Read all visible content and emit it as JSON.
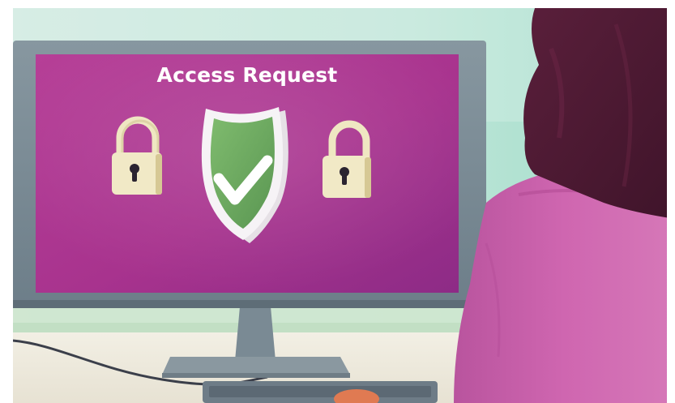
{
  "screen": {
    "title": "Access Request"
  },
  "icons": [
    "lock-icon",
    "shield-check-icon",
    "lock-icon"
  ],
  "colors": {
    "screen_magenta": "#a9338f",
    "shield_green": "#6aa55f",
    "lock_cream": "#f1e9c6",
    "person_pink": "#c55aa8",
    "hijab_maroon": "#4d1a33"
  }
}
